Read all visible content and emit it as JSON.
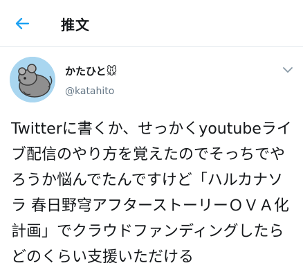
{
  "header": {
    "title": "推文",
    "back_icon": "arrow-left-icon"
  },
  "tweet": {
    "display_name": "かたひと",
    "name_emoji": "🐭",
    "username": "@katahito",
    "menu_icon": "chevron-down-icon",
    "text": "Twitterに書くか、せっかくyoutubeライブ配信のやり方を覚えたのでそっちでやろうか悩んでたんですけど「ハルカナソラ 春日野穹アフターストーリーＯＶＡ化計画」でクラウドファンディングしたらどのくらい支援いただける"
  },
  "colors": {
    "accent": "#1da1f2",
    "text": "#14171a",
    "secondary": "#657786",
    "avatar_bg": "#a9d6f0"
  }
}
